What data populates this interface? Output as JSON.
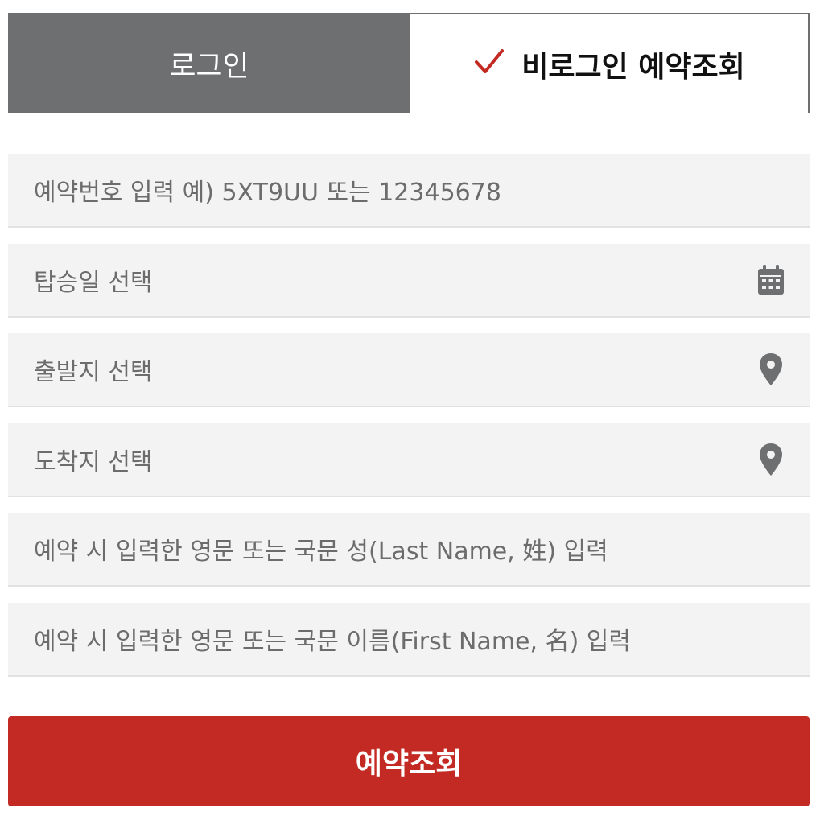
{
  "tabs": {
    "login_label": "로그인",
    "guest_label": "비로그인 예약조회"
  },
  "form": {
    "reservation_number": "예약번호 입력 예) 5XT9UU 또는 12345678",
    "boarding_date": "탑승일 선택",
    "departure": "출발지 선택",
    "arrival": "도착지 선택",
    "last_name": "예약 시 입력한 영문 또는 국문 성(Last Name, 姓) 입력",
    "first_name": "예약 시 입력한 영문 또는 국문 이름(First Name, 名) 입력"
  },
  "submit_label": "예약조회",
  "colors": {
    "accent": "#c42a24",
    "tab_inactive": "#6e6f71",
    "field_bg": "#f3f3f3"
  },
  "icons": {
    "check": "check-icon",
    "calendar": "calendar-icon",
    "location": "location-pin-icon"
  }
}
